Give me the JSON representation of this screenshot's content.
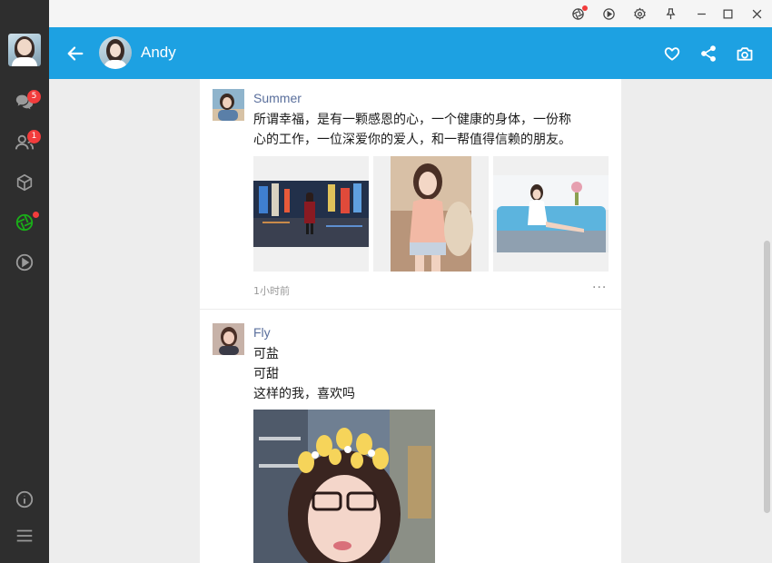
{
  "sidebar": {
    "badges": {
      "chat": "5",
      "contacts": "1"
    },
    "items": [
      {
        "icon": "chat-icon"
      },
      {
        "icon": "contacts-icon"
      },
      {
        "icon": "cube-icon"
      },
      {
        "icon": "aperture-icon"
      },
      {
        "icon": "play-icon"
      }
    ],
    "bottom": [
      {
        "icon": "info-icon"
      },
      {
        "icon": "menu-icon"
      }
    ]
  },
  "titlebar": {
    "icons": [
      "aperture-icon",
      "play-icon",
      "settings-icon",
      "pin-icon",
      "minimize-icon",
      "maximize-icon",
      "close-icon"
    ]
  },
  "header": {
    "title": "Andy",
    "actions": [
      "heart-icon",
      "share-icon",
      "camera-icon"
    ]
  },
  "posts": [
    {
      "name": "Summer",
      "text_lines": [
        "所谓幸福，是有一颗感恩的心，一个健康的身体，一份称",
        "心的工作，一位深爱你的爱人，和一帮值得信赖的朋友。"
      ],
      "time": "1小时前",
      "more": "···"
    },
    {
      "name": "Fly",
      "text_lines": [
        "可盐",
        "可甜",
        "这样的我，喜欢吗"
      ]
    }
  ],
  "colors": {
    "accent": "#1da1e2",
    "sidebar": "#2e2e2e",
    "badge": "#f23c3c",
    "name": "#5a6f9c",
    "online": "#1aad19"
  }
}
